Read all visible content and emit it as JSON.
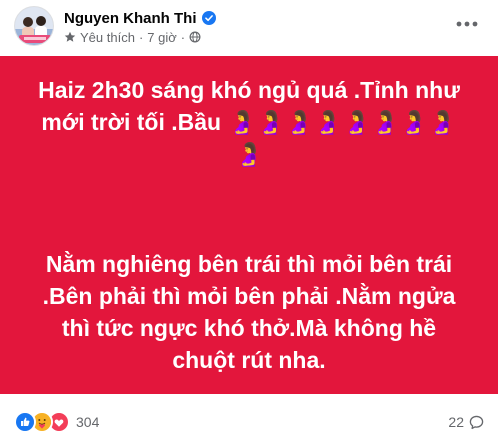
{
  "post": {
    "author": "Nguyen Khanh Thi",
    "audience_label": "Yêu thích",
    "separator": "·",
    "time": "7 giờ",
    "content": {
      "paragraphs": [
        "Haiz 2h30 sáng khó ngủ quá .Tỉnh như mới trời tối .Bầu 🤰🤰🤰🤰🤰🤰🤰🤰🤰",
        "Nằm nghiêng bên trái thì mỏi bên trái .Bên phải thì mỏi bên phải .Nằm ngửa thì tức ngực khó thở.Mà không hề chuột rút nha."
      ],
      "background_color": "#e3163c",
      "text_color": "#ffffff"
    },
    "reactions": {
      "icons": [
        "like-icon",
        "care-icon",
        "love-icon"
      ],
      "count": "304"
    },
    "comments": {
      "count": "22",
      "icon": "comment-icon"
    },
    "icons": {
      "verified": "verified-badge-icon",
      "favorite": "star-icon",
      "audience": "globe-icon",
      "more": "more-icon"
    },
    "colors": {
      "verified": "#1877f2",
      "like": "#1877f2",
      "love": "#f33e58",
      "care": "#f7b125",
      "secondary_text": "#65676b"
    }
  }
}
